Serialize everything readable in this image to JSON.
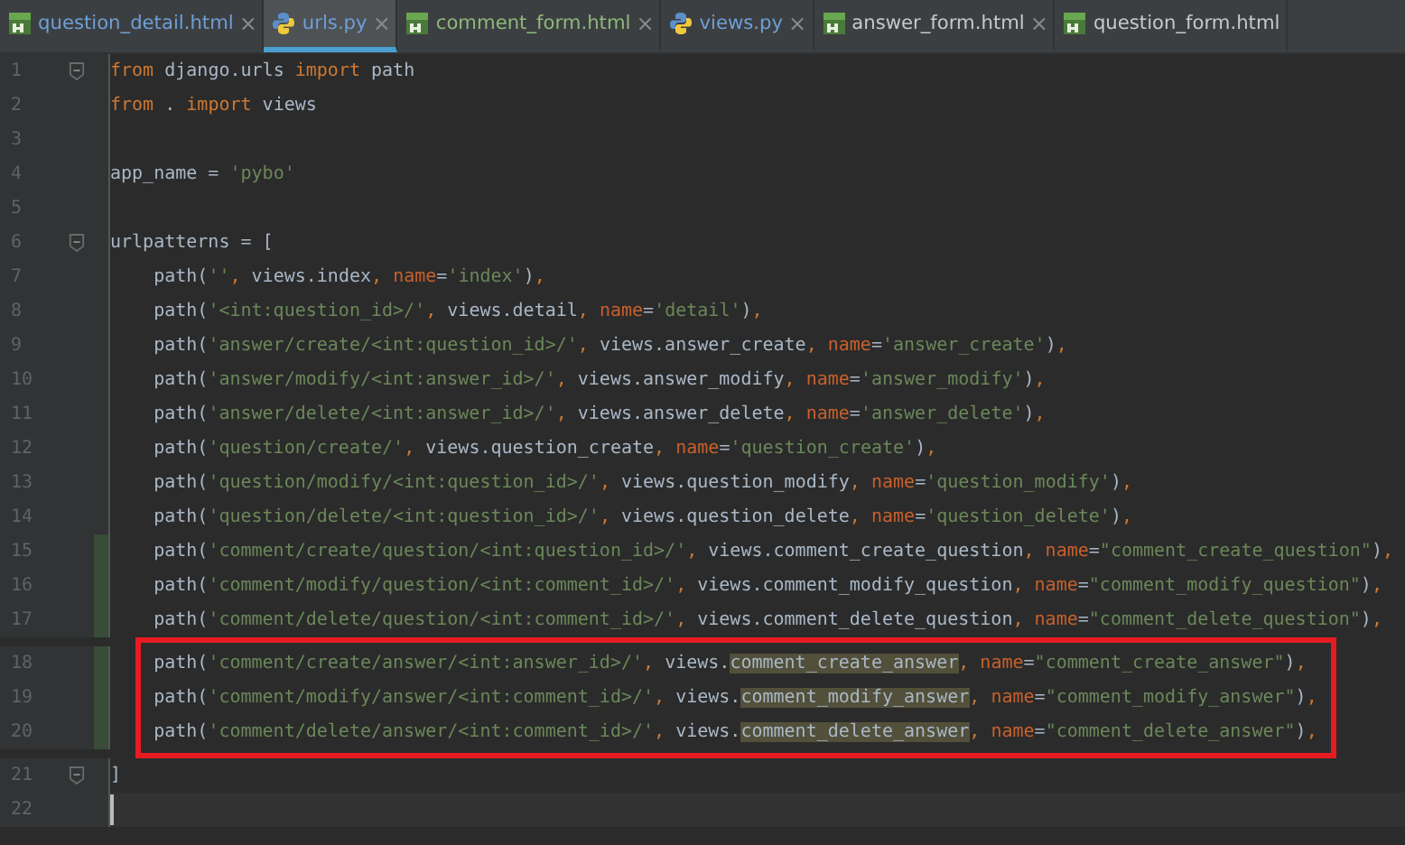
{
  "tabs": [
    {
      "label": "question_detail.html",
      "kind": "html",
      "color": "#6e9fd6",
      "selected": false,
      "close": "×"
    },
    {
      "label": "urls.py",
      "kind": "py",
      "color": "#6e9fd6",
      "selected": true,
      "close": "×"
    },
    {
      "label": "comment_form.html",
      "kind": "html",
      "color": "#8db87a",
      "selected": false,
      "close": "×"
    },
    {
      "label": "views.py",
      "kind": "py",
      "color": "#6e9fd6",
      "selected": false,
      "close": "×"
    },
    {
      "label": "answer_form.html",
      "kind": "html",
      "color": "#c8c8c8",
      "selected": false,
      "close": "×"
    },
    {
      "label": "question_form.html",
      "kind": "html",
      "color": "#c8c8c8",
      "selected": false
    }
  ],
  "lines": [
    {
      "number": "1",
      "fold": true,
      "tokens": [
        {
          "kind": "kw",
          "text": "from"
        },
        {
          "kind": "plain",
          "text": " django.urls "
        },
        {
          "kind": "kw",
          "text": "import"
        },
        {
          "kind": "plain",
          "text": " path"
        }
      ]
    },
    {
      "number": "2",
      "tokens": [
        {
          "kind": "kw",
          "text": "from"
        },
        {
          "kind": "plain",
          "text": " . "
        },
        {
          "kind": "kw",
          "text": "import"
        },
        {
          "kind": "plain",
          "text": " views"
        }
      ]
    },
    {
      "number": "3"
    },
    {
      "number": "4",
      "tokens": [
        {
          "kind": "plain",
          "text": "app_name = "
        },
        {
          "kind": "str",
          "text": "'pybo'"
        }
      ]
    },
    {
      "number": "5"
    },
    {
      "number": "6",
      "fold": true,
      "tokens": [
        {
          "kind": "plain",
          "text": "urlpatterns = ["
        }
      ]
    },
    {
      "number": "7",
      "tokens": [
        {
          "kind": "plain",
          "text": "    path("
        },
        {
          "kind": "str",
          "text": "''"
        },
        {
          "kind": "punct",
          "text": ", "
        },
        {
          "kind": "plain",
          "text": "views.index"
        },
        {
          "kind": "punct",
          "text": ", "
        },
        {
          "kind": "param",
          "text": "name"
        },
        {
          "kind": "plain",
          "text": "="
        },
        {
          "kind": "str",
          "text": "'index'"
        },
        {
          "kind": "plain",
          "text": ")"
        },
        {
          "kind": "punct",
          "text": ","
        }
      ]
    },
    {
      "number": "8",
      "tokens": [
        {
          "kind": "plain",
          "text": "    path("
        },
        {
          "kind": "str",
          "text": "'<int:question_id>/'"
        },
        {
          "kind": "punct",
          "text": ", "
        },
        {
          "kind": "plain",
          "text": "views.detail"
        },
        {
          "kind": "punct",
          "text": ", "
        },
        {
          "kind": "param",
          "text": "name"
        },
        {
          "kind": "plain",
          "text": "="
        },
        {
          "kind": "str",
          "text": "'detail'"
        },
        {
          "kind": "plain",
          "text": ")"
        },
        {
          "kind": "punct",
          "text": ","
        }
      ]
    },
    {
      "number": "9",
      "tokens": [
        {
          "kind": "plain",
          "text": "    path("
        },
        {
          "kind": "str",
          "text": "'answer/create/<int:question_id>/'"
        },
        {
          "kind": "punct",
          "text": ", "
        },
        {
          "kind": "plain",
          "text": "views.answer_create"
        },
        {
          "kind": "punct",
          "text": ", "
        },
        {
          "kind": "param",
          "text": "name"
        },
        {
          "kind": "plain",
          "text": "="
        },
        {
          "kind": "str",
          "text": "'answer_create'"
        },
        {
          "kind": "plain",
          "text": ")"
        },
        {
          "kind": "punct",
          "text": ","
        }
      ]
    },
    {
      "number": "10",
      "tokens": [
        {
          "kind": "plain",
          "text": "    path("
        },
        {
          "kind": "str",
          "text": "'answer/modify/<int:answer_id>/'"
        },
        {
          "kind": "punct",
          "text": ", "
        },
        {
          "kind": "plain",
          "text": "views.answer_modify"
        },
        {
          "kind": "punct",
          "text": ", "
        },
        {
          "kind": "param",
          "text": "name"
        },
        {
          "kind": "plain",
          "text": "="
        },
        {
          "kind": "str",
          "text": "'answer_modify'"
        },
        {
          "kind": "plain",
          "text": ")"
        },
        {
          "kind": "punct",
          "text": ","
        }
      ]
    },
    {
      "number": "11",
      "tokens": [
        {
          "kind": "plain",
          "text": "    path("
        },
        {
          "kind": "str",
          "text": "'answer/delete/<int:answer_id>/'"
        },
        {
          "kind": "punct",
          "text": ", "
        },
        {
          "kind": "plain",
          "text": "views.answer_delete"
        },
        {
          "kind": "punct",
          "text": ", "
        },
        {
          "kind": "param",
          "text": "name"
        },
        {
          "kind": "plain",
          "text": "="
        },
        {
          "kind": "str",
          "text": "'answer_delete'"
        },
        {
          "kind": "plain",
          "text": ")"
        },
        {
          "kind": "punct",
          "text": ","
        }
      ]
    },
    {
      "number": "12",
      "tokens": [
        {
          "kind": "plain",
          "text": "    path("
        },
        {
          "kind": "str",
          "text": "'question/create/'"
        },
        {
          "kind": "punct",
          "text": ", "
        },
        {
          "kind": "plain",
          "text": "views.question_create"
        },
        {
          "kind": "punct",
          "text": ", "
        },
        {
          "kind": "param",
          "text": "name"
        },
        {
          "kind": "plain",
          "text": "="
        },
        {
          "kind": "str",
          "text": "'question_create'"
        },
        {
          "kind": "plain",
          "text": ")"
        },
        {
          "kind": "punct",
          "text": ","
        }
      ]
    },
    {
      "number": "13",
      "tokens": [
        {
          "kind": "plain",
          "text": "    path("
        },
        {
          "kind": "str",
          "text": "'question/modify/<int:question_id>/'"
        },
        {
          "kind": "punct",
          "text": ", "
        },
        {
          "kind": "plain",
          "text": "views.question_modify"
        },
        {
          "kind": "punct",
          "text": ", "
        },
        {
          "kind": "param",
          "text": "name"
        },
        {
          "kind": "plain",
          "text": "="
        },
        {
          "kind": "str",
          "text": "'question_modify'"
        },
        {
          "kind": "plain",
          "text": ")"
        },
        {
          "kind": "punct",
          "text": ","
        }
      ]
    },
    {
      "number": "14",
      "tokens": [
        {
          "kind": "plain",
          "text": "    path("
        },
        {
          "kind": "str",
          "text": "'question/delete/<int:question_id>/'"
        },
        {
          "kind": "punct",
          "text": ", "
        },
        {
          "kind": "plain",
          "text": "views.question_delete"
        },
        {
          "kind": "punct",
          "text": ", "
        },
        {
          "kind": "param",
          "text": "name"
        },
        {
          "kind": "plain",
          "text": "="
        },
        {
          "kind": "str",
          "text": "'question_delete'"
        },
        {
          "kind": "plain",
          "text": ")"
        },
        {
          "kind": "punct",
          "text": ","
        }
      ]
    },
    {
      "number": "15",
      "changed": true,
      "tokens": [
        {
          "kind": "plain",
          "text": "    path("
        },
        {
          "kind": "str",
          "text": "'comment/create/question/<int:question_id>/'"
        },
        {
          "kind": "punct",
          "text": ", "
        },
        {
          "kind": "plain",
          "text": "views.comment_create_question"
        },
        {
          "kind": "punct",
          "text": ", "
        },
        {
          "kind": "param",
          "text": "name"
        },
        {
          "kind": "plain",
          "text": "="
        },
        {
          "kind": "str",
          "text": "\"comment_create_question\""
        },
        {
          "kind": "plain",
          "text": ")"
        },
        {
          "kind": "punct",
          "text": ","
        }
      ]
    },
    {
      "number": "16",
      "changed": true,
      "tokens": [
        {
          "kind": "plain",
          "text": "    path("
        },
        {
          "kind": "str",
          "text": "'comment/modify/question/<int:comment_id>/'"
        },
        {
          "kind": "punct",
          "text": ", "
        },
        {
          "kind": "plain",
          "text": "views.comment_modify_question"
        },
        {
          "kind": "punct",
          "text": ", "
        },
        {
          "kind": "param",
          "text": "name"
        },
        {
          "kind": "plain",
          "text": "="
        },
        {
          "kind": "str",
          "text": "\"comment_modify_question\""
        },
        {
          "kind": "plain",
          "text": ")"
        },
        {
          "kind": "punct",
          "text": ","
        }
      ]
    },
    {
      "number": "17",
      "changed": true,
      "tokens": [
        {
          "kind": "plain",
          "text": "    path("
        },
        {
          "kind": "str",
          "text": "'comment/delete/question/<int:comment_id>/'"
        },
        {
          "kind": "punct",
          "text": ", "
        },
        {
          "kind": "plain",
          "text": "views.comment_delete_question"
        },
        {
          "kind": "punct",
          "text": ", "
        },
        {
          "kind": "param",
          "text": "name"
        },
        {
          "kind": "plain",
          "text": "="
        },
        {
          "kind": "str",
          "text": "\"comment_delete_question\""
        },
        {
          "kind": "plain",
          "text": ")"
        },
        {
          "kind": "punct",
          "text": ","
        }
      ]
    },
    {
      "number": "18",
      "changed": true,
      "boxed": true,
      "tokens": [
        {
          "kind": "plain",
          "text": "    path("
        },
        {
          "kind": "str",
          "text": "'comment/create/answer/<int:answer_id>/'"
        },
        {
          "kind": "punct",
          "text": ", "
        },
        {
          "kind": "plain",
          "text": "views."
        },
        {
          "kind": "hl",
          "text": "comment_create_answer"
        },
        {
          "kind": "punct",
          "text": ", "
        },
        {
          "kind": "param",
          "text": "name"
        },
        {
          "kind": "plain",
          "text": "="
        },
        {
          "kind": "str",
          "text": "\"comment_create_answer\""
        },
        {
          "kind": "plain",
          "text": ")"
        },
        {
          "kind": "punct",
          "text": ","
        }
      ]
    },
    {
      "number": "19",
      "changed": true,
      "boxed": true,
      "tokens": [
        {
          "kind": "plain",
          "text": "    path("
        },
        {
          "kind": "str",
          "text": "'comment/modify/answer/<int:comment_id>/'"
        },
        {
          "kind": "punct",
          "text": ", "
        },
        {
          "kind": "plain",
          "text": "views."
        },
        {
          "kind": "hl",
          "text": "comment_modify_answer"
        },
        {
          "kind": "punct",
          "text": ", "
        },
        {
          "kind": "param",
          "text": "name"
        },
        {
          "kind": "plain",
          "text": "="
        },
        {
          "kind": "str",
          "text": "\"comment_modify_answer\""
        },
        {
          "kind": "plain",
          "text": ")"
        },
        {
          "kind": "punct",
          "text": ","
        }
      ]
    },
    {
      "number": "20",
      "changed": true,
      "boxed": true,
      "tokens": [
        {
          "kind": "plain",
          "text": "    path("
        },
        {
          "kind": "str",
          "text": "'comment/delete/answer/<int:comment_id>/'"
        },
        {
          "kind": "punct",
          "text": ", "
        },
        {
          "kind": "plain",
          "text": "views."
        },
        {
          "kind": "hl",
          "text": "comment_delete_answer"
        },
        {
          "kind": "punct",
          "text": ", "
        },
        {
          "kind": "param",
          "text": "name"
        },
        {
          "kind": "plain",
          "text": "="
        },
        {
          "kind": "str",
          "text": "\"comment_delete_answer\""
        },
        {
          "kind": "plain",
          "text": ")"
        },
        {
          "kind": "punct",
          "text": ","
        }
      ]
    },
    {
      "number": "21",
      "fold": true,
      "tokens": [
        {
          "kind": "plain",
          "text": "]"
        }
      ]
    },
    {
      "number": "22",
      "current": true
    }
  ]
}
